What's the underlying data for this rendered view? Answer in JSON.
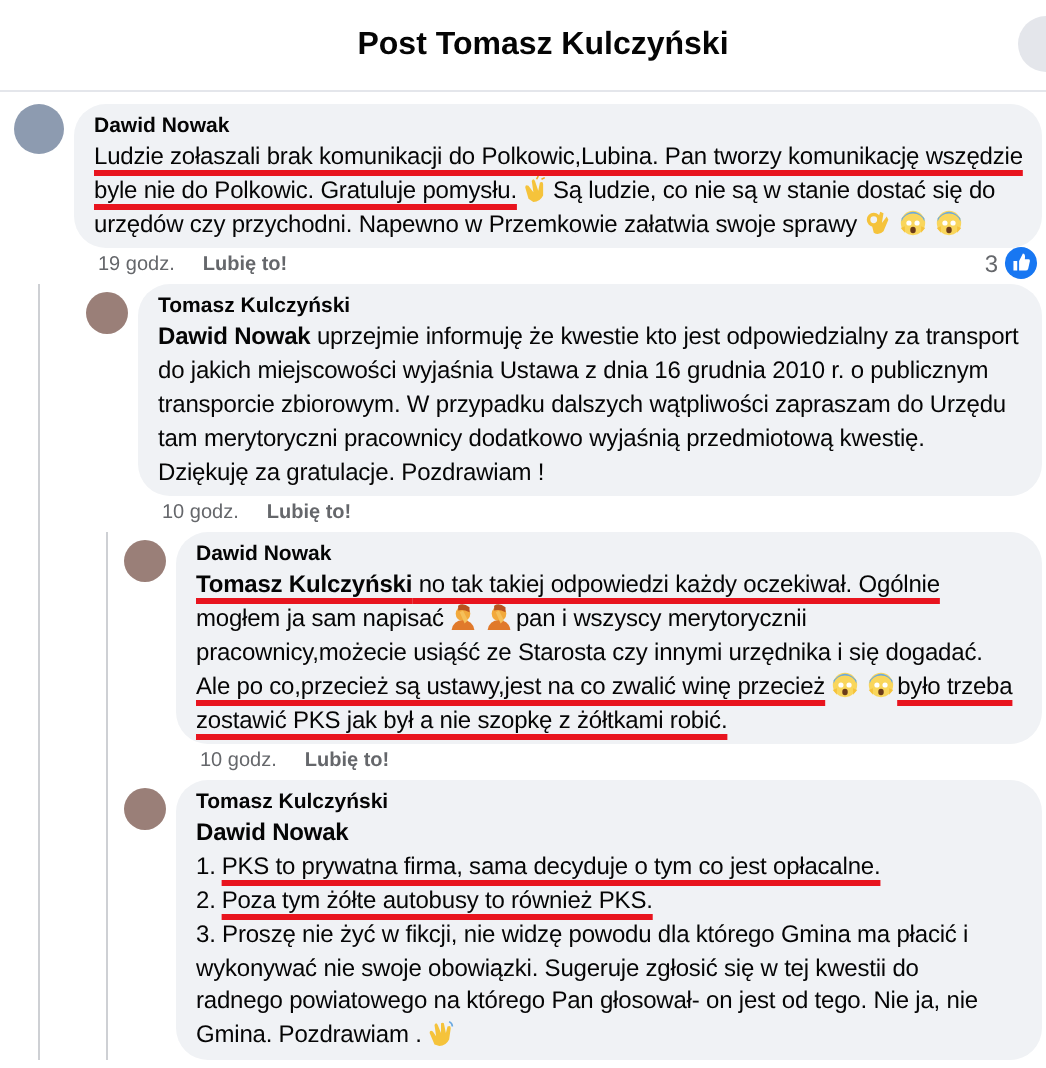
{
  "header": {
    "title": "Post Tomasz Kulczyński"
  },
  "comments": [
    {
      "author": "Dawid Nowak",
      "time": "19 godz.",
      "like_label": "Lubię to!",
      "reaction_count": "3",
      "lines": [
        [
          {
            "kind": "text",
            "text": "Ludzie zołaszali brak komunikacji do Polkowic,Lubina. Pan tworzy komunikację wszędzie",
            "marked": true
          }
        ],
        [
          {
            "kind": "text",
            "text": "byle nie do Polkowic. Gratuluje pomysłu.",
            "marked": true
          },
          {
            "kind": "clap"
          },
          {
            "kind": "text",
            "text": "Są ludzie, co nie są w stanie dostać się do",
            "marked": false
          }
        ],
        [
          {
            "kind": "text",
            "text": "urzędów czy przychodni. Napewno w Przemkowie załatwia swoje sprawy",
            "marked": false
          },
          {
            "kind": "ok"
          },
          {
            "kind": "scream"
          },
          {
            "kind": "scream"
          }
        ]
      ],
      "replies": [
        {
          "author": "Tomasz Kulczyński",
          "time": "10 godz.",
          "like_label": "Lubię to!",
          "lines": [
            [
              {
                "kind": "text",
                "text": "**Dawid Nowak** uprzejmie informuję że kwestie kto jest odpowiedzialny za transport",
                "marked": false
              }
            ],
            [
              {
                "kind": "text",
                "text": "do jakich miejscowości wyjaśnia Ustawa z dnia 16 grudnia 2010 r. o publicznym",
                "marked": false
              }
            ],
            [
              {
                "kind": "text",
                "text": "transporcie zbiorowym. W przypadku dalszych wątpliwości zapraszam do Urzędu",
                "marked": false
              }
            ],
            [
              {
                "kind": "text",
                "text": "tam merytoryczni pracownicy dodatkowo wyjaśnią przedmiotową kwestię.",
                "marked": false
              }
            ],
            [
              {
                "kind": "text",
                "text": "Dziękuję za gratulacje. Pozdrawiam !",
                "marked": false
              }
            ]
          ],
          "replies": [
            {
              "author": "Dawid Nowak",
              "time": "10 godz.",
              "like_label": "Lubię to!",
              "lines": [
                [
                  {
                    "kind": "text",
                    "text": "**Tomasz Kulczyński** no tak takiej odpowiedzi każdy oczekiwał. Ogólnie",
                    "marked": true
                  }
                ],
                [
                  {
                    "kind": "text",
                    "text": "mogłem ja sam napisać",
                    "marked": false
                  },
                  {
                    "kind": "facepalm"
                  },
                  {
                    "kind": "facepalm"
                  },
                  {
                    "kind": "text",
                    "text": "pan i wszyscy merytorycznii",
                    "marked": false
                  }
                ],
                [
                  {
                    "kind": "text",
                    "text": "pracownicy,możecie usiąść ze Starosta czy innymi urzędnika i się dogadać.",
                    "marked": false
                  }
                ],
                [
                  {
                    "kind": "text",
                    "text": "Ale po co,przecież są ustawy,jest na co zwalić winę przecież",
                    "marked": true
                  },
                  {
                    "kind": "scream"
                  },
                  {
                    "kind": "scream"
                  },
                  {
                    "kind": "text",
                    "text": "było trzeba",
                    "marked": true
                  }
                ],
                [
                  {
                    "kind": "text",
                    "text": "zostawić PKS jak był a nie szopkę z żółtkami robić.",
                    "marked": true
                  }
                ]
              ]
            },
            {
              "author": "Tomasz Kulczyński",
              "lines": [
                [
                  {
                    "kind": "mention",
                    "text": "Dawid Nowak"
                  }
                ],
                [
                  {
                    "kind": "text",
                    "text": "1.",
                    "marked": false
                  },
                  {
                    "kind": "text",
                    "text": "PKS to prywatna firma, sama decyduje o tym co jest opłacalne.",
                    "marked": true
                  }
                ],
                [
                  {
                    "kind": "text",
                    "text": "2.",
                    "marked": false
                  },
                  {
                    "kind": "text",
                    "text": "Poza tym żółte autobusy to również PKS.",
                    "marked": true
                  }
                ],
                [
                  {
                    "kind": "text",
                    "text": "3. Proszę nie żyć w fikcji, nie widzę powodu dla którego Gmina ma płacić i",
                    "marked": false
                  }
                ],
                [
                  {
                    "kind": "text",
                    "text": "wykonywać nie swoje obowiązki. Sugeruje zgłosić się w tej kwestii do",
                    "marked": false
                  }
                ],
                [
                  {
                    "kind": "text",
                    "text": "radnego powiatowego na którego Pan głosował- on jest od tego. Nie ja, nie",
                    "marked": false
                  }
                ],
                [
                  {
                    "kind": "text",
                    "text": "Gmina. Pozdrawiam .",
                    "marked": false
                  },
                  {
                    "kind": "wave"
                  }
                ]
              ]
            }
          ]
        }
      ]
    }
  ]
}
